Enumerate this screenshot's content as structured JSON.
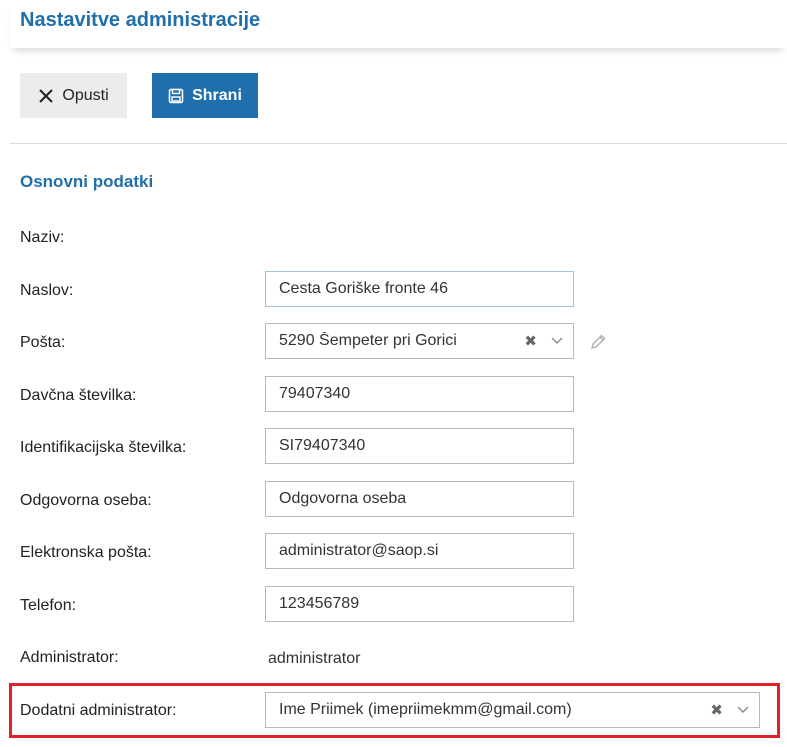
{
  "header": {
    "title": "Nastavitve administracije"
  },
  "toolbar": {
    "cancel_label": "Opusti",
    "save_label": "Shrani"
  },
  "section": {
    "title": "Osnovni podatki"
  },
  "form": {
    "naziv": {
      "label": "Naziv:"
    },
    "naslov": {
      "label": "Naslov:",
      "value": "Cesta Goriške fronte 46"
    },
    "posta": {
      "label": "Pošta:",
      "value": "5290 Šempeter pri Gorici"
    },
    "davcna": {
      "label": "Davčna številka:",
      "value": "79407340"
    },
    "identifikacijska": {
      "label": "Identifikacijska številka:",
      "value": "SI79407340"
    },
    "odgovorna": {
      "label": "Odgovorna oseba:",
      "value": "Odgovorna oseba"
    },
    "email": {
      "label": "Elektronska pošta:",
      "value": "administrator@saop.si"
    },
    "telefon": {
      "label": "Telefon:",
      "value": "123456789"
    },
    "administrator": {
      "label": "Administrator:",
      "value": "administrator"
    },
    "dodatni": {
      "label": "Dodatni administrator:",
      "value": "Ime Priimek (imepriimekmm@gmail.com)"
    }
  },
  "colors": {
    "accent": "#1f6fad",
    "highlight": "#e3202a"
  }
}
